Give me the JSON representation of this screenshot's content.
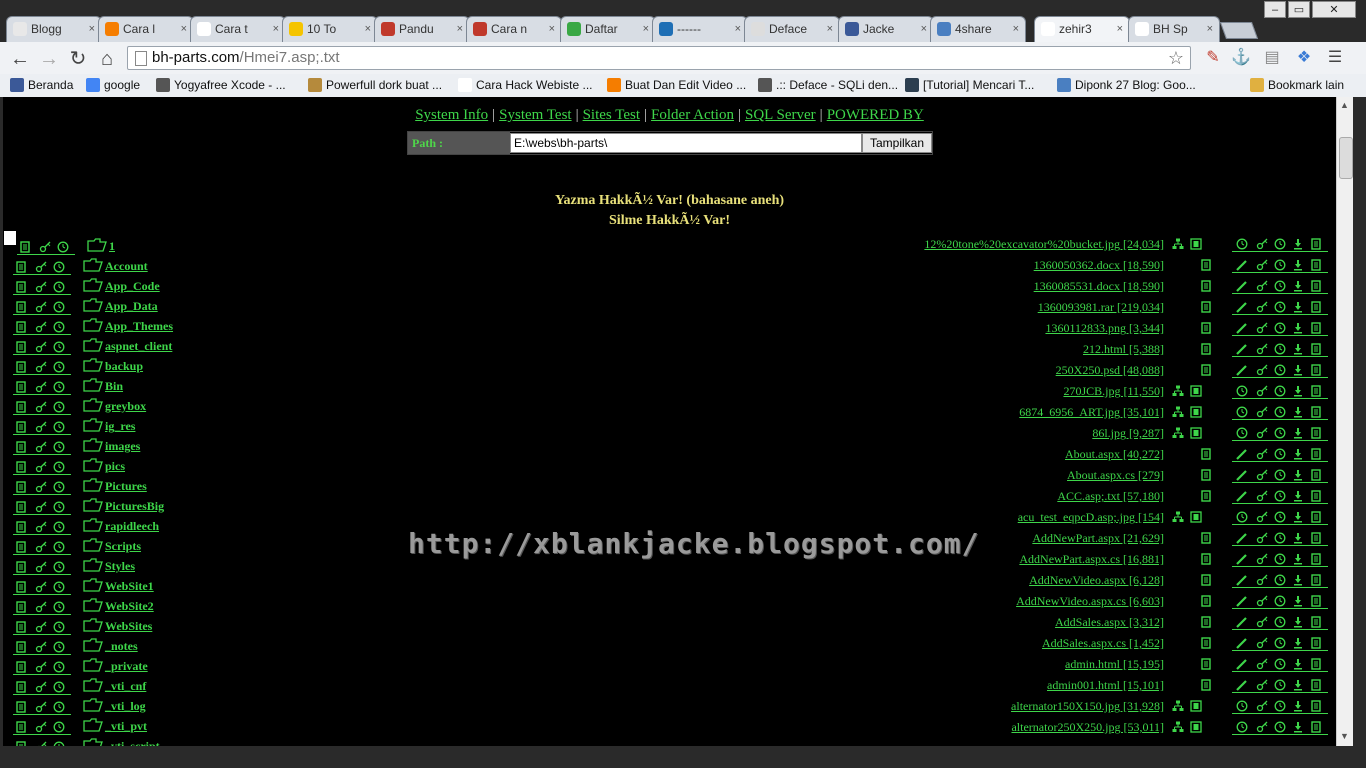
{
  "browser": {
    "tabs": [
      {
        "label": "Blogg",
        "color": "#e8e8e8"
      },
      {
        "label": "Cara l",
        "color": "#f57d00"
      },
      {
        "label": "Cara t",
        "color": "#ffffff"
      },
      {
        "label": "10 To",
        "color": "#f5c400"
      },
      {
        "label": "Pandu",
        "color": "#c0392b"
      },
      {
        "label": "Cara n",
        "color": "#c0392b"
      },
      {
        "label": "Daftar",
        "color": "#39a845"
      },
      {
        "label": "------",
        "color": "#1f6fb5"
      },
      {
        "label": "Deface",
        "color": "#dddddd"
      },
      {
        "label": "Jacke",
        "color": "#3b5998"
      },
      {
        "label": "4share",
        "color": "#4a7fc1"
      },
      {
        "label": "zehir3",
        "color": "#ffffff"
      },
      {
        "label": "BH Sp",
        "color": "#ffffff"
      }
    ],
    "active_tab": 11,
    "window_controls": [
      "–",
      "▭",
      "✕"
    ],
    "url_host": "bh-parts.com",
    "url_rest": "/Hmei7.asp;.txt",
    "bookmarks": [
      {
        "label": "Beranda",
        "color": "#3b5998"
      },
      {
        "label": "google",
        "color": "#4285f4"
      },
      {
        "label": "Yogyafree Xcode - ...",
        "color": "#555555"
      },
      {
        "label": "Powerfull dork buat ...",
        "color": "#b58a3c"
      },
      {
        "label": "Cara Hack Webiste ...",
        "color": "#ffffff"
      },
      {
        "label": "Buat Dan Edit Video ...",
        "color": "#f57d00"
      },
      {
        "label": ".:: Deface - SQLi den...",
        "color": "#555555"
      },
      {
        "label": "[Tutorial] Mencari T...",
        "color": "#2c3e50"
      },
      {
        "label": "Diponk 27 Blog: Goo...",
        "color": "#4a7fc1"
      },
      {
        "label": "Bookmark lain",
        "color": "#e0b040"
      }
    ]
  },
  "shell": {
    "menu": [
      "System Info",
      "System Test",
      "Sites Test",
      "Folder Action",
      "SQL Server",
      "POWERED BY"
    ],
    "menu_sep": "|",
    "path_label": "Path :",
    "path_value": "E:\\webs\\bh-parts\\",
    "path_button": "Tampilkan",
    "notice_write": "Yazma HakkÃ½ Var! (bahasane aneh)",
    "notice_delete": "Silme HakkÃ½ Var!",
    "watermark": "http://xblankjacke.blogspot.com/",
    "folders": [
      "1",
      "Account",
      "App_Code",
      "App_Data",
      "App_Themes",
      "aspnet_client",
      "backup",
      "Bin",
      "greybox",
      "ig_res",
      "images",
      "pics",
      "Pictures",
      "PicturesBig",
      "rapidleech",
      "Scripts",
      "Styles",
      "WebSite1",
      "WebSite2",
      "WebSites",
      "_notes",
      "_private",
      "_vti_cnf",
      "_vti_log",
      "_vti_pvt",
      "_vti_script"
    ],
    "files": [
      {
        "name": "12%20tone%20excavator%20bucket.jpg [24,034]",
        "kind": "image"
      },
      {
        "name": "1360050362.docx [18,590]",
        "kind": "doc"
      },
      {
        "name": "1360085531.docx [18,590]",
        "kind": "doc"
      },
      {
        "name": "1360093981.rar [219,034]",
        "kind": "doc"
      },
      {
        "name": "1360112833.png [3,344]",
        "kind": "doc"
      },
      {
        "name": "212.html [5,388]",
        "kind": "doc"
      },
      {
        "name": "250X250.psd [48,088]",
        "kind": "doc"
      },
      {
        "name": "270JCB.jpg [11,550]",
        "kind": "image"
      },
      {
        "name": "6874_6956_ART.jpg [35,101]",
        "kind": "image"
      },
      {
        "name": "86l.jpg [9,287]",
        "kind": "image"
      },
      {
        "name": "About.aspx [40,272]",
        "kind": "doc"
      },
      {
        "name": "About.aspx.cs [279]",
        "kind": "doc"
      },
      {
        "name": "ACC.asp;.txt [57,180]",
        "kind": "doc"
      },
      {
        "name": "acu_test_eqpcD.asp;.jpg [154]",
        "kind": "image"
      },
      {
        "name": "AddNewPart.aspx [21,629]",
        "kind": "doc"
      },
      {
        "name": "AddNewPart.aspx.cs [16,881]",
        "kind": "doc"
      },
      {
        "name": "AddNewVideo.aspx [6,128]",
        "kind": "doc"
      },
      {
        "name": "AddNewVideo.aspx.cs [6,603]",
        "kind": "doc"
      },
      {
        "name": "AddSales.aspx [3,312]",
        "kind": "doc"
      },
      {
        "name": "AddSales.aspx.cs [1,452]",
        "kind": "doc"
      },
      {
        "name": "admin.html [15,195]",
        "kind": "doc"
      },
      {
        "name": "admin001.html [15,101]",
        "kind": "doc"
      },
      {
        "name": "alternator150X150.jpg [31,928]",
        "kind": "image"
      },
      {
        "name": "alternator250X250.jpg [53,011]",
        "kind": "image"
      }
    ],
    "accent": "#3ed64a",
    "notice_color": "#e8e07a"
  }
}
